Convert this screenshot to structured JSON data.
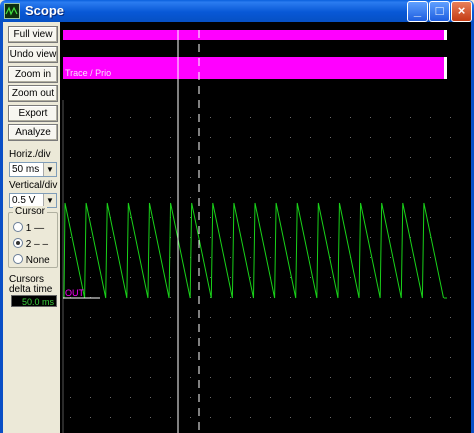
{
  "window": {
    "title": "Scope",
    "minimize_glyph": "_",
    "maximize_glyph": "□",
    "close_glyph": "×"
  },
  "toolbar": {
    "full_view": "Full view",
    "undo_view": "Undo view",
    "zoom_in": "Zoom in",
    "zoom_out": "Zoom out",
    "export": "Export",
    "analyze": "Analyze"
  },
  "settings": {
    "horiz_label": "Horiz./div",
    "horiz_value": "50 ms",
    "vert_label": "Vertical/div",
    "vert_value": "0.5 V"
  },
  "cursor": {
    "group_label": "Cursor",
    "options": [
      "1 —",
      "2 – –",
      "None"
    ],
    "selected": "2 – –"
  },
  "readout": {
    "label_line1": "Cursors",
    "label_line2": "delta time",
    "value": "50.0 ms"
  },
  "display": {
    "trace_label": "Trace / Prio",
    "signal_label": "OUT",
    "colors": {
      "background": "#000000",
      "trace_bar": "#ff00ff",
      "signal": "#19d219",
      "grid_dot": "#6a6a6a",
      "cursor": "#ffffff"
    }
  }
}
